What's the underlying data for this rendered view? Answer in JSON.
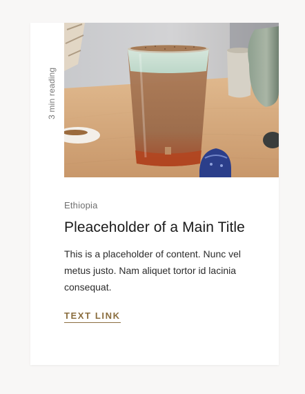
{
  "card": {
    "reading_time": "3 min reading",
    "eyebrow": "Ethiopia",
    "title": "Pleaceholder of a Main Title",
    "body": "This is a placeholder of content.  Nunc vel metus justo. Nam aliquet tortor id lacinia consequat.",
    "link_label": "TEXT LINK",
    "colors": {
      "link": "#8a6d3e",
      "background": "#f8f7f6",
      "card": "#ffffff"
    }
  }
}
